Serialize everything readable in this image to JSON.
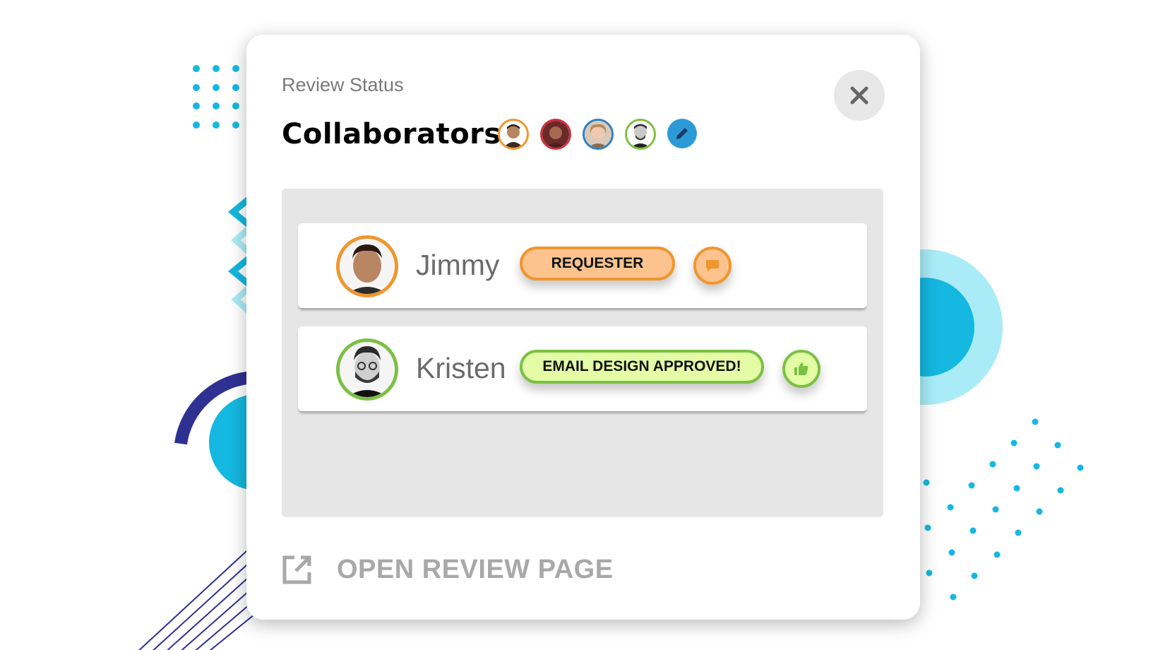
{
  "header": {
    "subtitle": "Review Status",
    "title": "Collaborators"
  },
  "collaborator_avatars": [
    {
      "name": "avatar-1",
      "ring": "#f0962e"
    },
    {
      "name": "avatar-2",
      "ring": "#d32f3c"
    },
    {
      "name": "avatar-3",
      "ring": "#2d7fc1"
    },
    {
      "name": "avatar-4",
      "ring": "#7cc043"
    }
  ],
  "rows": [
    {
      "name": "Jimmy",
      "status": "REQUESTER",
      "action_icon": "comment-icon",
      "accent": "#f0962e",
      "pill_fill": "#fdc38f"
    },
    {
      "name": "Kristen",
      "status": "EMAIL DESIGN APPROVED!",
      "action_icon": "thumbs-up-icon",
      "accent": "#7cc043",
      "pill_fill": "#e4fca6"
    }
  ],
  "footer": {
    "open_label": "OPEN REVIEW PAGE"
  },
  "icons": [
    "close-icon",
    "pencil-icon",
    "external-link-icon"
  ]
}
